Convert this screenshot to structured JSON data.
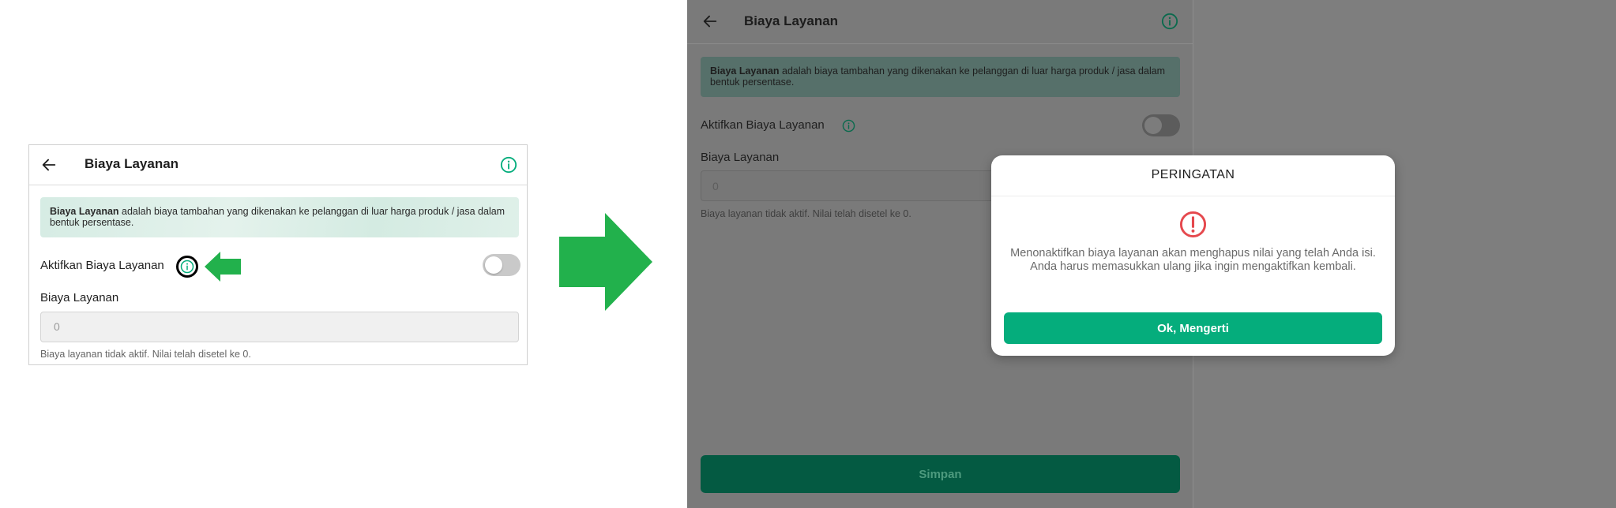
{
  "left_panel": {
    "title": "Biaya Layanan",
    "description_bold": "Biaya Layanan",
    "description_rest": " adalah biaya tambahan yang dikenakan ke pelanggan di luar harga produk / jasa dalam bentuk persentase.",
    "toggle_label": "Aktifkan Biaya Layanan",
    "toggle_on": false,
    "field_label": "Biaya Layanan",
    "input_value": "0",
    "helper_text": "Biaya layanan tidak aktif. Nilai telah disetel ke 0.",
    "icons": [
      "back-arrow-icon",
      "info-icon",
      "pointer-arrow-icon"
    ]
  },
  "transition_arrow": "right-arrow-icon",
  "right_screen": {
    "title": "Biaya Layanan",
    "description_bold": "Biaya Layanan",
    "description_rest": " adalah biaya tambahan yang dikenakan ke pelanggan di luar harga produk / jasa dalam bentuk persentase.",
    "toggle_label": "Aktifkan Biaya Layanan",
    "toggle_on": false,
    "field_label": "Biaya Layanan",
    "input_value": "0",
    "helper_text": "Biaya layanan tidak aktif. Nilai telah disetel ke 0.",
    "save_label": "Simpan",
    "dialog": {
      "title": "PERINGATAN",
      "icon": "warning-icon",
      "message": "Menonaktifkan biaya layanan akan menghapus nilai yang telah Anda isi. Anda harus memasukkan ulang jika ingin mengaktifkan kembali.",
      "ok_label": "Ok, Mengerti"
    }
  },
  "colors": {
    "brand_green": "#05ad7c",
    "annotation_green": "#22b14c",
    "warning_red": "#e5484d"
  }
}
